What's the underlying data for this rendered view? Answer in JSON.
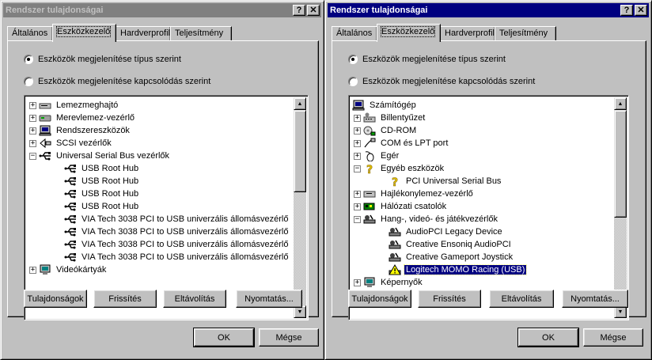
{
  "windows": [
    {
      "title": "Rendszer tulajdonságai",
      "help_glyph": "?",
      "close_glyph": "✕",
      "tabs": [
        "Általános",
        "Eszközkezelő",
        "Hardverprofil",
        "Teljesítmény"
      ],
      "selected_tab": 1,
      "radio_by_type": "Eszközök megjelenítése típus szerint",
      "radio_by_connection": "Eszközök megjelenítése kapcsolódás szerint",
      "radio_selected": "by_type",
      "tree": [
        {
          "indent": 0,
          "expander": "+",
          "icon": "floppy-drive-icon",
          "label": "Lemezmeghajtó"
        },
        {
          "indent": 0,
          "expander": "+",
          "icon": "hard-disk-controller-icon",
          "label": "Merevlemez-vezérlő"
        },
        {
          "indent": 0,
          "expander": "+",
          "icon": "computer-icon",
          "label": "Rendszereszközök"
        },
        {
          "indent": 0,
          "expander": "+",
          "icon": "scsi-icon",
          "label": "SCSI vezérlők"
        },
        {
          "indent": 0,
          "expander": "−",
          "icon": "usb-icon",
          "label": "Universal Serial Bus vezérlők"
        },
        {
          "indent": 1,
          "expander": "",
          "icon": "usb-icon",
          "label": "USB Root Hub"
        },
        {
          "indent": 1,
          "expander": "",
          "icon": "usb-icon",
          "label": "USB Root Hub"
        },
        {
          "indent": 1,
          "expander": "",
          "icon": "usb-icon",
          "label": "USB Root Hub"
        },
        {
          "indent": 1,
          "expander": "",
          "icon": "usb-icon",
          "label": "USB Root Hub"
        },
        {
          "indent": 1,
          "expander": "",
          "icon": "usb-icon",
          "label": "VIA Tech 3038 PCI to USB univerzális állomásvezérlő"
        },
        {
          "indent": 1,
          "expander": "",
          "icon": "usb-icon",
          "label": "VIA Tech 3038 PCI to USB univerzális állomásvezérlő"
        },
        {
          "indent": 1,
          "expander": "",
          "icon": "usb-icon",
          "label": "VIA Tech 3038 PCI to USB univerzális állomásvezérlő"
        },
        {
          "indent": 1,
          "expander": "",
          "icon": "usb-icon",
          "label": "VIA Tech 3038 PCI to USB univerzális állomásvezérlő"
        },
        {
          "indent": 0,
          "expander": "+",
          "icon": "monitor-icon",
          "label": "Videókártyák"
        }
      ],
      "scroll": {
        "thumb_start_fraction": 0.0,
        "thumb_size_fraction": 0.42
      },
      "buttons": [
        "Tulajdonságok",
        "Frissítés",
        "Eltávolítás",
        "Nyomtatás..."
      ],
      "ok": "OK",
      "cancel": "Mégse"
    },
    {
      "title": "Rendszer tulajdonságai",
      "help_glyph": "?",
      "close_glyph": "✕",
      "tabs": [
        "Általános",
        "Eszközkezelő",
        "Hardverprofil",
        "Teljesítmény"
      ],
      "selected_tab": 1,
      "radio_by_type": "Eszközök megjelenítése típus szerint",
      "radio_by_connection": "Eszközök megjelenítése kapcsolódás szerint",
      "radio_selected": "by_type",
      "tree": [
        {
          "indent": -1,
          "expander": "",
          "icon": "computer-icon",
          "label": "Számítógép"
        },
        {
          "indent": 0,
          "expander": "+",
          "icon": "keyboard-icon",
          "label": "Billentyűzet"
        },
        {
          "indent": 0,
          "expander": "+",
          "icon": "cdrom-icon",
          "label": "CD-ROM"
        },
        {
          "indent": 0,
          "expander": "+",
          "icon": "port-icon",
          "label": "COM és LPT port"
        },
        {
          "indent": 0,
          "expander": "+",
          "icon": "mouse-icon",
          "label": "Egér"
        },
        {
          "indent": 0,
          "expander": "−",
          "icon": "question-icon",
          "label": "Egyéb eszközök"
        },
        {
          "indent": 1,
          "expander": "",
          "icon": "question-icon",
          "label": "PCI Universal Serial Bus"
        },
        {
          "indent": 0,
          "expander": "+",
          "icon": "floppy-controller-icon",
          "label": "Hajlékonylemez-vezérlő"
        },
        {
          "indent": 0,
          "expander": "+",
          "icon": "network-adapter-icon",
          "label": "Hálózati csatolók"
        },
        {
          "indent": 0,
          "expander": "−",
          "icon": "sound-icon",
          "label": "Hang-, videó- és játékvezérlők"
        },
        {
          "indent": 1,
          "expander": "",
          "icon": "sound-icon",
          "label": "AudioPCI Legacy Device"
        },
        {
          "indent": 1,
          "expander": "",
          "icon": "sound-icon",
          "label": "Creative Ensoniq AudioPCI"
        },
        {
          "indent": 1,
          "expander": "",
          "icon": "sound-icon",
          "label": "Creative Gameport Joystick"
        },
        {
          "indent": 1,
          "expander": "",
          "icon": "warning-device-icon",
          "label": "Logitech MOMO Racing (USB)",
          "selected": true
        },
        {
          "indent": 0,
          "expander": "+",
          "icon": "monitor-icon",
          "label": "Képernyők"
        }
      ],
      "scroll": {
        "thumb_start_fraction": 0.0,
        "thumb_size_fraction": 0.55
      },
      "buttons": [
        "Tulajdonságok",
        "Frissítés",
        "Eltávolítás",
        "Nyomtatás..."
      ],
      "ok": "OK",
      "cancel": "Mégse"
    }
  ]
}
